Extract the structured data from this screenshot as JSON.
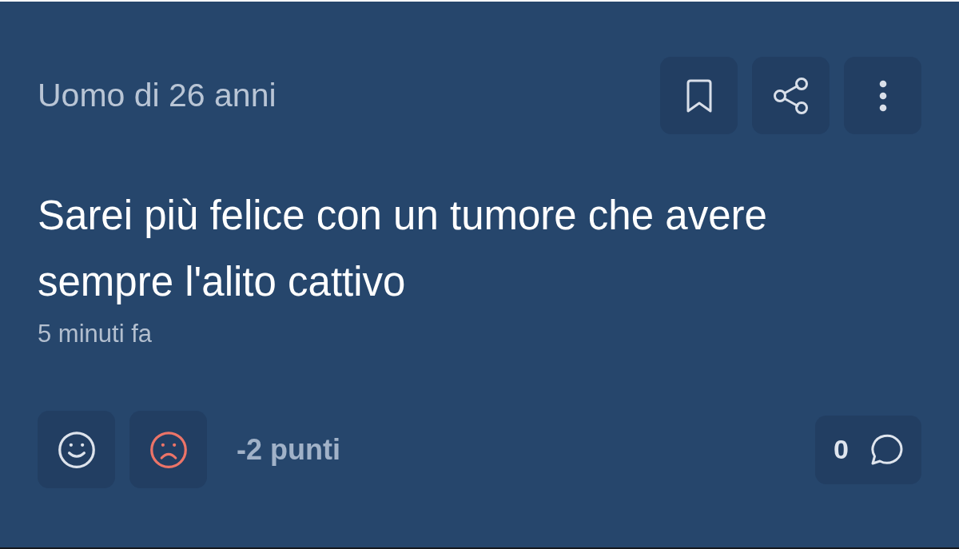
{
  "post": {
    "author": "Uomo di 26 anni",
    "text": "Sarei più felice con un tumore che avere sempre l'alito cattivo",
    "time": "5 minuti fa",
    "reactions": [
      {
        "kind": "like",
        "selected": false
      },
      {
        "kind": "dislike",
        "selected": true
      }
    ],
    "score": "-2 punti",
    "comments": "0"
  }
}
